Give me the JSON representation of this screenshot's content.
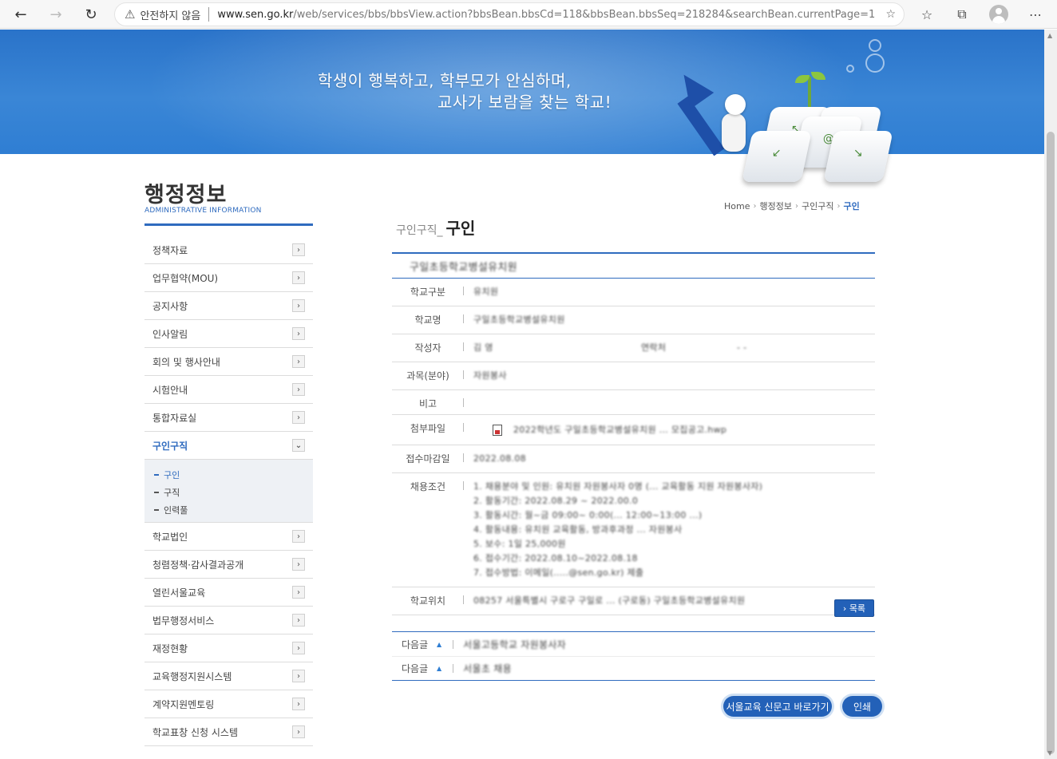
{
  "browser": {
    "security_label": "안전하지 않음",
    "url_host": "www.sen.go.kr",
    "url_path": "/web/services/bbs/bbsView.action?bbsBean.bbsCd=118&bbsBean.bbsSeq=218284&searchBean.currentPage=1"
  },
  "banner": {
    "slogan_line1": "학생이 행복하고, 학부모가 안심하며,",
    "slogan_line2": "교사가 보람을 찾는 학교!"
  },
  "sidebar": {
    "title": "행정정보",
    "subtitle": "ADMINISTRATIVE INFORMATION",
    "items": [
      {
        "label": "정책자료"
      },
      {
        "label": "업무협약(MOU)"
      },
      {
        "label": "공지사항"
      },
      {
        "label": "인사알림"
      },
      {
        "label": "회의 및 행사안내"
      },
      {
        "label": "시험안내"
      },
      {
        "label": "통합자료실"
      },
      {
        "label": "구인구직"
      },
      {
        "label": "학교법인"
      },
      {
        "label": "청렴정책·감사결과공개"
      },
      {
        "label": "열린서울교육"
      },
      {
        "label": "법무행정서비스"
      },
      {
        "label": "재정현황"
      },
      {
        "label": "교육행정지원시스템"
      },
      {
        "label": "계약지원멘토링"
      },
      {
        "label": "학교표창 신청 시스템"
      }
    ],
    "sub_items": [
      {
        "label": "구인"
      },
      {
        "label": "구직"
      },
      {
        "label": "인력풀"
      }
    ]
  },
  "breadcrumb": {
    "home": "Home",
    "level1": "행정정보",
    "level2": "구인구직",
    "current": "구인"
  },
  "content": {
    "title_prefix": "구인구직_",
    "title_main": "구인"
  },
  "detail": {
    "heading": "구일초등학교병설유치원",
    "rows": [
      {
        "label": "학교구분",
        "value": "유치원"
      },
      {
        "label": "학교명",
        "value": "구일초등학교병설유치원"
      },
      {
        "label": "작성자",
        "value": "김 영",
        "extra1": "연락처",
        "extra2": "- -"
      },
      {
        "label": "과목(분야)",
        "value": "자원봉사"
      },
      {
        "label": "비고",
        "value": ""
      },
      {
        "label": "첨부파일",
        "value": "2022학년도 구일초등학교병설유치원 ... 모집공고.hwp"
      },
      {
        "label": "접수마감일",
        "value": "2022.08.08"
      },
      {
        "label": "채용조건",
        "lines": [
          "1. 채용분야 및 인원: 유치원 자원봉사자 0명 (... 교육활동 지원 자원봉사자)",
          "2. 활동기간: 2022.08.29 ~ 2022.00.0",
          "3. 활동시간: 월~금 09:00~ 0:00(... 12:00~13:00 ...)",
          "4. 활동내용: 유치원 교육활동, 방과후과정 ... 자원봉사",
          "5. 보수: 1일 25,000원",
          "6. 접수기간: 2022.08.10~2022.08.18",
          "7. 접수방법: 이메일(.....@sen.go.kr) 제출"
        ]
      },
      {
        "label": "학교위치",
        "value": "08257 서울특별시 구로구 구일로 ... (구로동) 구일초등학교병설유치원"
      }
    ]
  },
  "buttons": {
    "list": "› 목록",
    "newsroom": "서울교육 신문고 바로가기",
    "print": "인쇄"
  },
  "prevnext": [
    {
      "label": "다음글",
      "title": "서울고등학교 자원봉사자"
    },
    {
      "label": "다음글",
      "title": "서울초 채용"
    }
  ]
}
